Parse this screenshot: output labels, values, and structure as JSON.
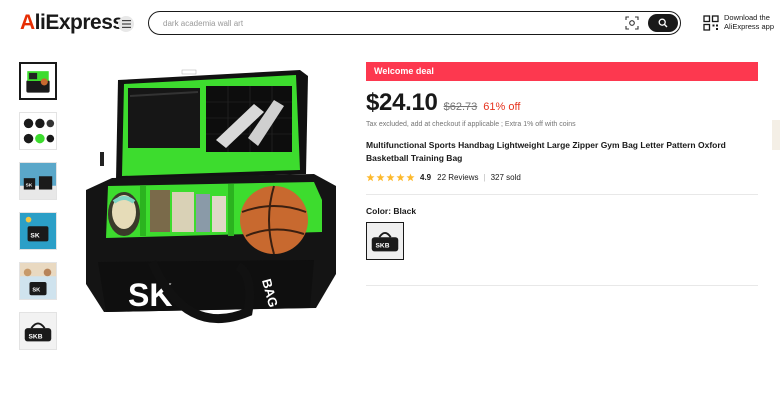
{
  "header": {
    "logo_prefix": "A",
    "logo_rest": "liExpress",
    "search_placeholder": "dark academia wall art",
    "app_download": "Download the AliExpress app"
  },
  "product": {
    "welcome_banner": "Welcome deal",
    "price": "$24.10",
    "original_price": "$62.73",
    "discount": "61% off",
    "tax_note": "Tax excluded, add at checkout if applicable ; Extra 1% off with coins",
    "title": "Multifunctional Sports Handbag Lightweight Large Zipper Gym Bag Letter Pattern Oxford Basketball Training Bag",
    "rating_score": "4.9",
    "reviews": "22 Reviews",
    "sold": "327 sold",
    "stars": 5,
    "color_label": "Color: Black"
  },
  "colors": {
    "accent_red": "#fd384f",
    "price_red": "#e6331e",
    "star_yellow": "#fdb92c",
    "bag_green": "#3ddc2e"
  }
}
